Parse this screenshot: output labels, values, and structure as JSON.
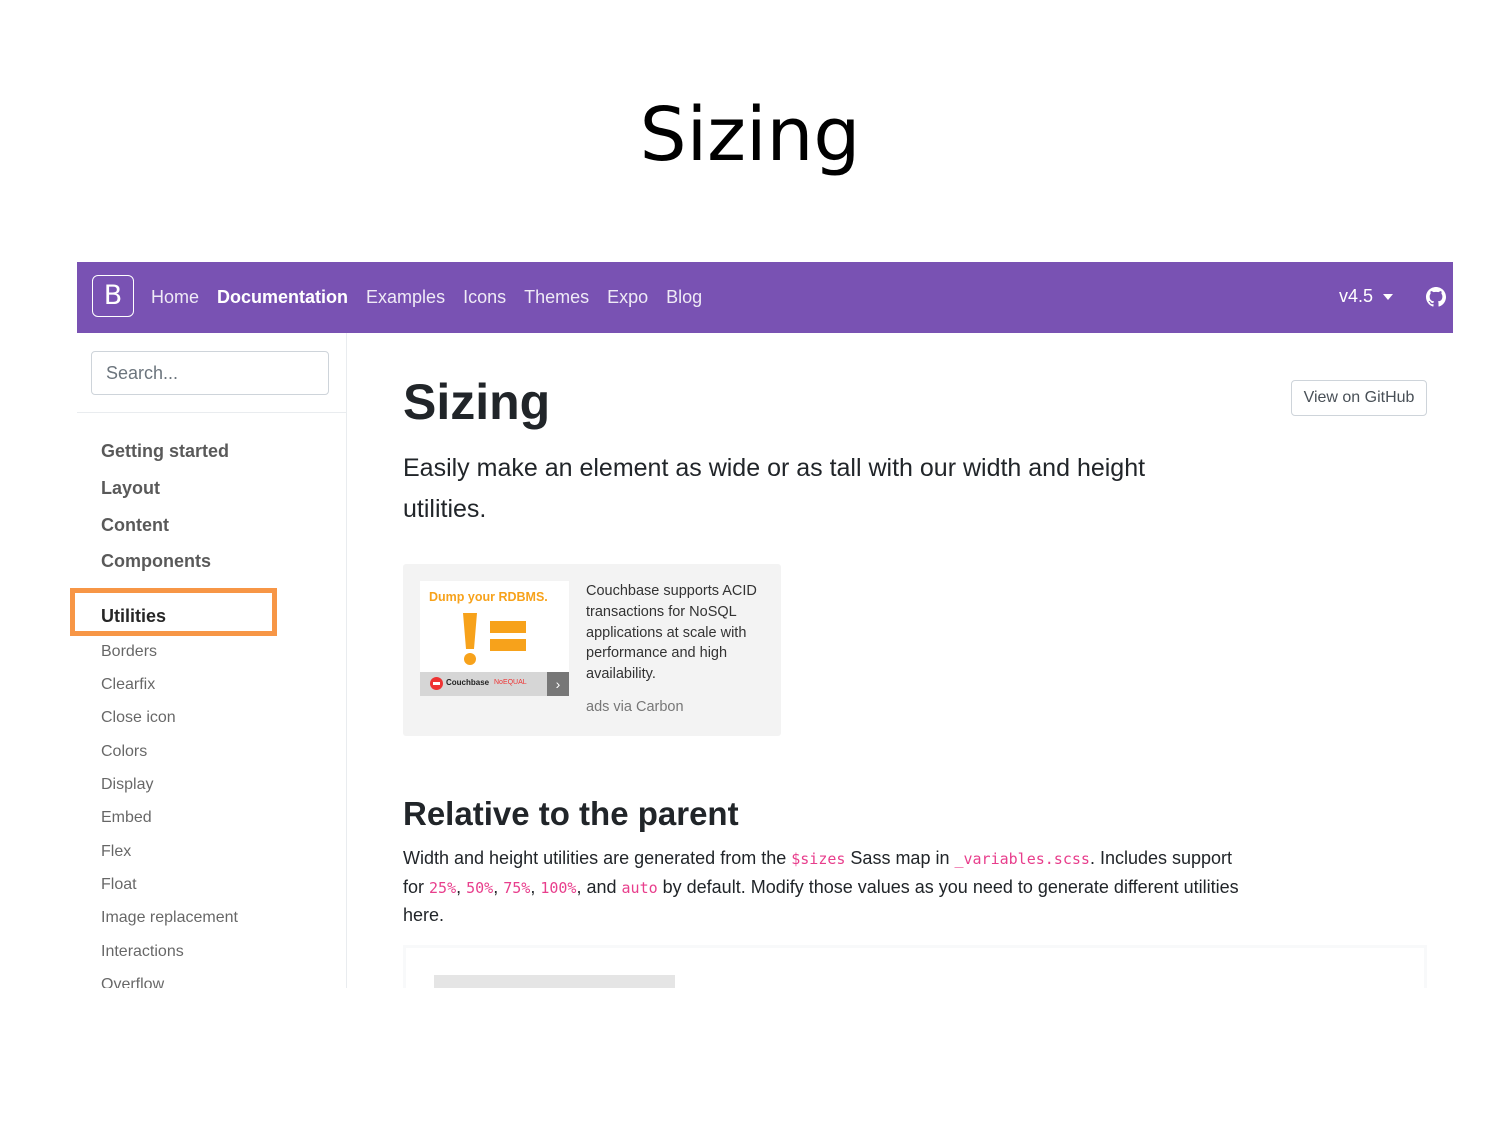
{
  "slide": {
    "title": "Sizing"
  },
  "navbar": {
    "brand": "B",
    "links": [
      "Home",
      "Documentation",
      "Examples",
      "Icons",
      "Themes",
      "Expo",
      "Blog"
    ],
    "active": "Documentation",
    "version": "v4.5",
    "github_icon": "github-icon",
    "bg_color": "#7952b3"
  },
  "sidebar": {
    "search_placeholder": "Search...",
    "groups": [
      "Getting started",
      "Layout",
      "Content",
      "Components",
      "Utilities"
    ],
    "active_group": "Utilities",
    "items": [
      "Borders",
      "Clearfix",
      "Close icon",
      "Colors",
      "Display",
      "Embed",
      "Flex",
      "Float",
      "Image replacement",
      "Interactions",
      "Overflow"
    ],
    "highlight_color": "#f79646"
  },
  "main": {
    "title": "Sizing",
    "github_button": "View on GitHub",
    "lead": "Easily make an element as wide or as tall with our width and height utilities.",
    "ad": {
      "headline": "Dump your RDBMS.",
      "brand": "Couchbase",
      "tagline": "NoEQUAL",
      "text": "Couchbase supports ACID transactions for NoSQL applications at scale with performance and high availability.",
      "via": "ads via Carbon"
    },
    "section_title": "Relative to the parent",
    "para": {
      "t1": "Width and height utilities are generated from the ",
      "c1": "$sizes",
      "t2": " Sass map in ",
      "c2": "_variables.scss",
      "t3": ". Includes support for ",
      "c3": "25%",
      "t4": ", ",
      "c4": "50%",
      "t5": ", ",
      "c5": "75%",
      "t6": ", ",
      "c6": "100%",
      "t7": ", and ",
      "c7": "auto",
      "t8": " by default. Modify those values as you need to generate different utilities here."
    }
  }
}
